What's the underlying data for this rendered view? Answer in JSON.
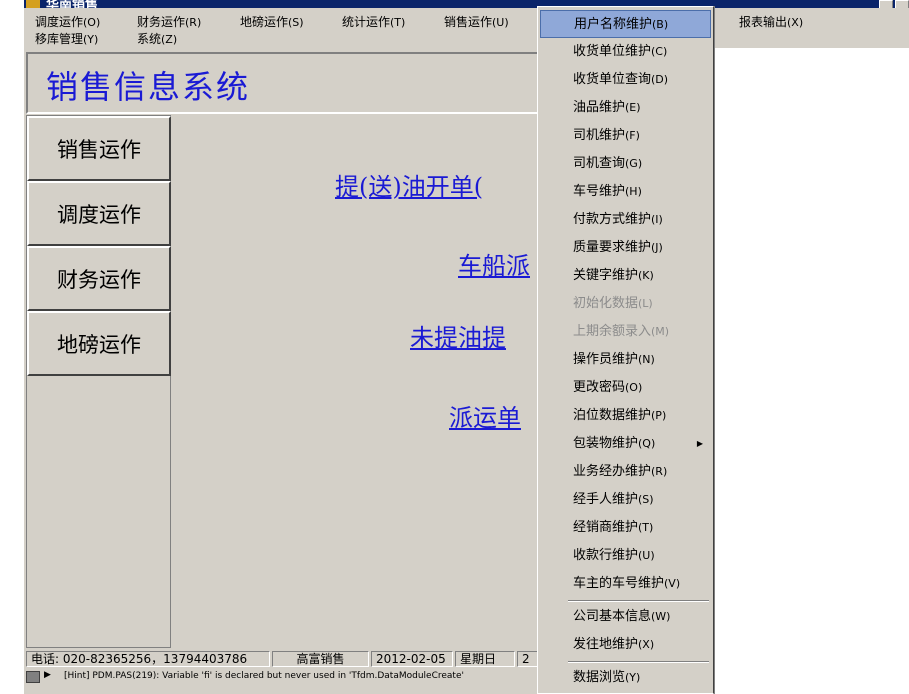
{
  "window": {
    "title": "华南销售"
  },
  "menubar": {
    "items": [
      {
        "label": "调度运作",
        "accel": "(O)"
      },
      {
        "label": "财务运作",
        "accel": "(R)"
      },
      {
        "label": "地磅运作",
        "accel": "(S)"
      },
      {
        "label": "统计运作",
        "accel": "(T)"
      },
      {
        "label": "销售运作",
        "accel": "(U)"
      },
      {
        "label": "报表输出",
        "accel": "(X)"
      },
      {
        "label": "移库管理",
        "accel": "(Y)"
      },
      {
        "label": "系统",
        "accel": "(Z)"
      }
    ]
  },
  "banner": {
    "title": "销售信息系统"
  },
  "nav": {
    "buttons": [
      "销售运作",
      "调度运作",
      "财务运作",
      "地磅运作"
    ]
  },
  "content": {
    "links": [
      "提(送)油开单(",
      "车船派",
      "未提油提",
      "派运单"
    ]
  },
  "status": {
    "phone": "电话:  020-82365256，13794403786",
    "company": "高富销售",
    "date": "2012-02-05",
    "weekday": "星期日",
    "extra": "2"
  },
  "hint": {
    "text": "[Hint] PDM.PAS(219): Variable 'fi' is declared but never used in 'Tfdm.DataModuleCreate'"
  },
  "dropdown": {
    "items": [
      {
        "label": "用户名称维护",
        "accel": "(B)",
        "state": "selected"
      },
      {
        "label": "收货单位维护",
        "accel": "(C)",
        "state": "normal"
      },
      {
        "label": "收货单位查询",
        "accel": "(D)",
        "state": "normal"
      },
      {
        "label": "油品维护",
        "accel": "(E)",
        "state": "normal"
      },
      {
        "label": "司机维护",
        "accel": "(F)",
        "state": "normal"
      },
      {
        "label": "司机查询",
        "accel": "(G)",
        "state": "normal"
      },
      {
        "label": "车号维护",
        "accel": "(H)",
        "state": "normal"
      },
      {
        "label": "付款方式维护",
        "accel": "(I)",
        "state": "normal"
      },
      {
        "label": "质量要求维护",
        "accel": "(J)",
        "state": "normal"
      },
      {
        "label": "关键字维护",
        "accel": "(K)",
        "state": "normal"
      },
      {
        "label": "初始化数据",
        "accel": "(L)",
        "state": "disabled"
      },
      {
        "label": "上期余额录入",
        "accel": "(M)",
        "state": "disabled"
      },
      {
        "label": "操作员维护",
        "accel": "(N)",
        "state": "normal"
      },
      {
        "label": "更改密码",
        "accel": "(O)",
        "state": "normal"
      },
      {
        "label": "泊位数据维护",
        "accel": "(P)",
        "state": "normal"
      },
      {
        "label": "包装物维护",
        "accel": "(Q)",
        "state": "normal",
        "submenu": true
      },
      {
        "label": "业务经办维护",
        "accel": "(R)",
        "state": "normal"
      },
      {
        "label": "经手人维护",
        "accel": "(S)",
        "state": "normal"
      },
      {
        "label": "经销商维护",
        "accel": "(T)",
        "state": "normal"
      },
      {
        "label": "收款行维护",
        "accel": "(U)",
        "state": "normal"
      },
      {
        "label": "车主的车号维护",
        "accel": "(V)",
        "state": "normal"
      },
      {
        "label": "公司基本信息",
        "accel": "(W)",
        "state": "normal"
      },
      {
        "label": "发往地维护",
        "accel": "(X)",
        "state": "normal"
      },
      {
        "label": "数据浏览",
        "accel": "(Y)",
        "state": "normal"
      }
    ],
    "submenu_icon": "submenu-arrow-icon"
  },
  "colors": {
    "face": "#d4d0c8",
    "titlebar": "#0a246a",
    "link": "#1a1ad4",
    "selection": "#8fa8d8"
  }
}
